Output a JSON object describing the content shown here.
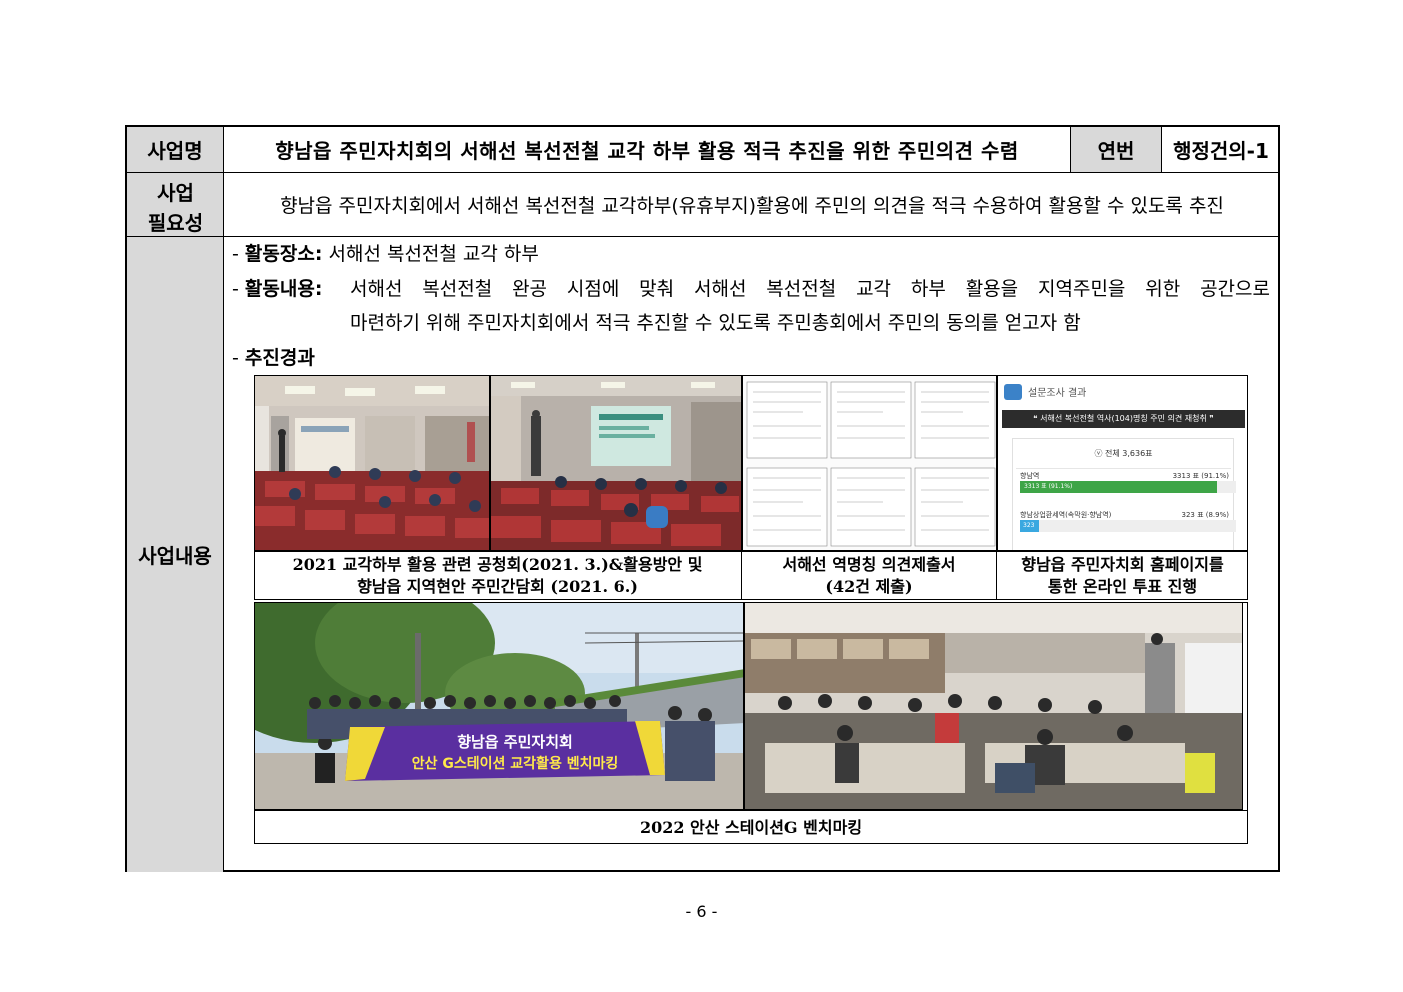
{
  "header": {
    "label_project": "사업명",
    "project_title": "향남읍 주민자치회의 서해선 복선전철 교각 하부 활용 적극 추진을 위한 주민의견 수렴",
    "label_serial": "연번",
    "serial_value": "행정건의-1"
  },
  "necessity": {
    "label_line1": "사업",
    "label_line2": "필요성",
    "text": "향남읍 주민자치회에서 서해선 복선전철 교각하부(유휴부지)활용에 주민의 의견을 적극 수용하여 활용할 수 있도록 추진"
  },
  "content": {
    "label": "사업내용",
    "place_key": "활동장소:",
    "place_value": "서해선 복선전철 교각 하부",
    "activity_key": "활동내용:",
    "activity_line1": "서해선 복선전철 완공 시점에 맞춰 서해선 복선전철 교각 하부 활용을 지역주민을 위한 공간으로",
    "activity_line2": "마련하기 위해 주민자치회에서 적극 추진할 수 있도록 주민총회에서 주민의 동의를 얻고자 함",
    "progress_key": "추진경과",
    "dash": "-"
  },
  "photos": {
    "caption1_line1": "2021 교각하부 활용 관련 공청회(2021. 3.)&활용방안 및",
    "caption1_line2": "향남읍 지역현안 주민간담회 (2021. 6.)",
    "caption2_line1": "서해선 역명칭 의견제출서",
    "caption2_line2": "(42건 제출)",
    "caption3_line1": "향남읍 주민자치회 홈페이지를",
    "caption3_line2": "통한 온라인 투표 진행",
    "caption4": "2022 안산 스테이션G 벤치마킹",
    "survey": {
      "header": "설문조사 결과",
      "question": "❝ 서해선 복선전철 역사(104)명칭 주민 의견 재청취 ❞",
      "total": "ⓥ 전체 3,636표",
      "opt1_name": "향남역",
      "opt1_count": "3313 표 (91.1%)",
      "opt1_bar": "3313 표 (91.1%)",
      "opt1_pct": 91.1,
      "opt2_name": "향남상업환세역(속막원·향남역)",
      "opt2_count": "323 표 (8.9%)",
      "opt2_bar": "323",
      "opt2_pct": 8.9
    },
    "banner_line1": "향남읍 주민자치회",
    "banner_line2": "안산 G스테이션 교각활용 벤치마킹"
  },
  "footer": {
    "page": "- 6 -"
  }
}
